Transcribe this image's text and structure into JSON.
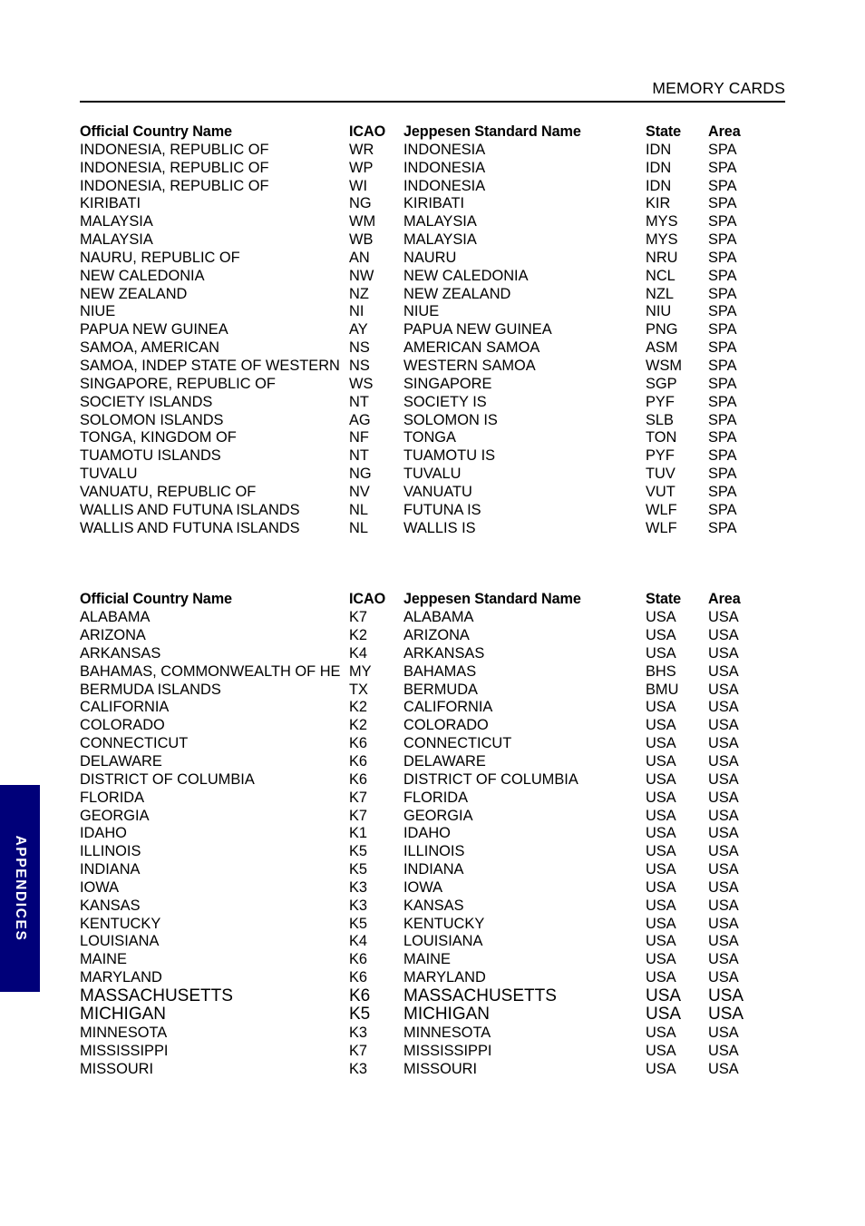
{
  "header": {
    "title": "MEMORY CARDS"
  },
  "side_tab": {
    "label": "APPENDICES",
    "background_color": "#000079",
    "text_color": "#ffffff"
  },
  "tables": [
    {
      "id": "south-pacific-table",
      "columns": [
        "Official Country Name",
        "ICAO",
        "Jeppesen Standard Name",
        "State",
        "Area"
      ],
      "rows": [
        [
          "INDONESIA, REPUBLIC OF",
          "WR",
          "INDONESIA",
          "IDN",
          "SPA"
        ],
        [
          "INDONESIA, REPUBLIC OF",
          "WP",
          "INDONESIA",
          "IDN",
          "SPA"
        ],
        [
          "INDONESIA, REPUBLIC OF",
          "WI",
          "INDONESIA",
          "IDN",
          "SPA"
        ],
        [
          "KIRIBATI",
          "NG",
          "KIRIBATI",
          "KIR",
          "SPA"
        ],
        [
          "MALAYSIA",
          "WM",
          "MALAYSIA",
          "MYS",
          "SPA"
        ],
        [
          "MALAYSIA",
          "WB",
          "MALAYSIA",
          "MYS",
          "SPA"
        ],
        [
          "NAURU, REPUBLIC OF",
          "AN",
          "NAURU",
          "NRU",
          "SPA"
        ],
        [
          "NEW CALEDONIA",
          "NW",
          "NEW CALEDONIA",
          "NCL",
          "SPA"
        ],
        [
          "NEW ZEALAND",
          "NZ",
          "NEW ZEALAND",
          "NZL",
          "SPA"
        ],
        [
          "NIUE",
          "NI",
          "NIUE",
          "NIU",
          "SPA"
        ],
        [
          "PAPUA NEW GUINEA",
          "AY",
          "PAPUA NEW GUINEA",
          "PNG",
          "SPA"
        ],
        [
          "SAMOA, AMERICAN",
          "NS",
          "AMERICAN SAMOA",
          "ASM",
          "SPA"
        ],
        [
          "SAMOA, INDEP STATE OF WESTERN",
          "NS",
          "WESTERN SAMOA",
          "WSM",
          "SPA"
        ],
        [
          "SINGAPORE, REPUBLIC OF",
          "WS",
          "SINGAPORE",
          "SGP",
          "SPA"
        ],
        [
          "SOCIETY ISLANDS",
          "NT",
          "SOCIETY IS",
          "PYF",
          "SPA"
        ],
        [
          "SOLOMON ISLANDS",
          "AG",
          "SOLOMON IS",
          "SLB",
          "SPA"
        ],
        [
          "TONGA, KINGDOM OF",
          "NF",
          "TONGA",
          "TON",
          "SPA"
        ],
        [
          "TUAMOTU ISLANDS",
          "NT",
          "TUAMOTU IS",
          "PYF",
          "SPA"
        ],
        [
          "TUVALU",
          "NG",
          "TUVALU",
          "TUV",
          "SPA"
        ],
        [
          "VANUATU, REPUBLIC OF",
          "NV",
          "VANUATU",
          "VUT",
          "SPA"
        ],
        [
          "WALLIS AND FUTUNA ISLANDS",
          "NL",
          "FUTUNA IS",
          "WLF",
          "SPA"
        ],
        [
          "WALLIS AND FUTUNA ISLANDS",
          "NL",
          "WALLIS IS",
          "WLF",
          "SPA"
        ]
      ],
      "big_rows": []
    },
    {
      "id": "usa-table",
      "columns": [
        "Official Country Name",
        "ICAO",
        "Jeppesen Standard Name",
        "State",
        "Area"
      ],
      "rows": [
        [
          "ALABAMA",
          "K7",
          "ALABAMA",
          "USA",
          "USA"
        ],
        [
          "ARIZONA",
          "K2",
          "ARIZONA",
          "USA",
          "USA"
        ],
        [
          "ARKANSAS",
          "K4",
          "ARKANSAS",
          "USA",
          "USA"
        ],
        [
          "BAHAMAS, COMMONWEALTH OF HE",
          "MY",
          "BAHAMAS",
          "BHS",
          "USA"
        ],
        [
          "BERMUDA ISLANDS",
          "TX",
          "BERMUDA",
          "BMU",
          "USA"
        ],
        [
          "CALIFORNIA",
          "K2",
          "CALIFORNIA",
          "USA",
          "USA"
        ],
        [
          "COLORADO",
          "K2",
          "COLORADO",
          "USA",
          "USA"
        ],
        [
          "CONNECTICUT",
          "K6",
          "CONNECTICUT",
          "USA",
          "USA"
        ],
        [
          "DELAWARE",
          "K6",
          "DELAWARE",
          "USA",
          "USA"
        ],
        [
          "DISTRICT OF COLUMBIA",
          "K6",
          "DISTRICT OF COLUMBIA",
          "USA",
          "USA"
        ],
        [
          "FLORIDA",
          "K7",
          "FLORIDA",
          "USA",
          "USA"
        ],
        [
          "GEORGIA",
          "K7",
          "GEORGIA",
          "USA",
          "USA"
        ],
        [
          "IDAHO",
          "K1",
          "IDAHO",
          "USA",
          "USA"
        ],
        [
          "ILLINOIS",
          "K5",
          "ILLINOIS",
          "USA",
          "USA"
        ],
        [
          "INDIANA",
          "K5",
          "INDIANA",
          "USA",
          "USA"
        ],
        [
          "IOWA",
          "K3",
          "IOWA",
          "USA",
          "USA"
        ],
        [
          "KANSAS",
          "K3",
          "KANSAS",
          "USA",
          "USA"
        ],
        [
          "KENTUCKY",
          "K5",
          "KENTUCKY",
          "USA",
          "USA"
        ],
        [
          "LOUISIANA",
          "K4",
          "LOUISIANA",
          "USA",
          "USA"
        ],
        [
          "MAINE",
          "K6",
          "MAINE",
          "USA",
          "USA"
        ],
        [
          "MARYLAND",
          "K6",
          "MARYLAND",
          "USA",
          "USA"
        ],
        [
          "MASSACHUSETTS",
          "K6",
          "MASSACHUSETTS",
          "USA",
          "USA"
        ],
        [
          "MICHIGAN",
          "K5",
          "MICHIGAN",
          "USA",
          "USA"
        ],
        [
          "MINNESOTA",
          "K3",
          "MINNESOTA",
          "USA",
          "USA"
        ],
        [
          "MISSISSIPPI",
          "K7",
          "MISSISSIPPI",
          "USA",
          "USA"
        ],
        [
          "MISSOURI",
          "K3",
          "MISSOURI",
          "USA",
          "USA"
        ]
      ],
      "big_rows": [
        21,
        22
      ]
    }
  ]
}
